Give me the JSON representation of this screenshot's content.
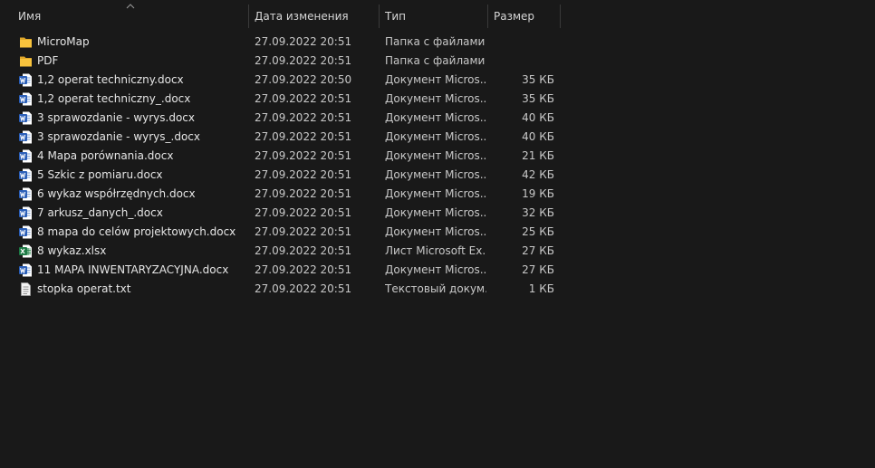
{
  "columns": {
    "name": "Имя",
    "date": "Дата изменения",
    "type": "Тип",
    "size": "Размер"
  },
  "sort": {
    "column": "name",
    "direction": "ascending",
    "indicator": "chevron-up-icon"
  },
  "colors": {
    "background": "#191919",
    "folder": "#f8c33d",
    "word": "#2b5fb8",
    "excel": "#1d7a45"
  },
  "files": [
    {
      "name": "MicroMap",
      "date": "27.09.2022 20:51",
      "type": "Папка с файлами",
      "size": "",
      "icon": "folder-icon"
    },
    {
      "name": "PDF",
      "date": "27.09.2022 20:51",
      "type": "Папка с файлами",
      "size": "",
      "icon": "folder-icon"
    },
    {
      "name": "1,2 operat techniczny.docx",
      "date": "27.09.2022 20:50",
      "type": "Документ Micros...",
      "size": "35 КБ",
      "icon": "word-document-icon"
    },
    {
      "name": "1,2 operat techniczny_.docx",
      "date": "27.09.2022 20:51",
      "type": "Документ Micros...",
      "size": "35 КБ",
      "icon": "word-document-icon"
    },
    {
      "name": "3 sprawozdanie - wyrys.docx",
      "date": "27.09.2022 20:51",
      "type": "Документ Micros...",
      "size": "40 КБ",
      "icon": "word-document-icon"
    },
    {
      "name": "3 sprawozdanie - wyrys_.docx",
      "date": "27.09.2022 20:51",
      "type": "Документ Micros...",
      "size": "40 КБ",
      "icon": "word-document-icon"
    },
    {
      "name": "4 Mapa porównania.docx",
      "date": "27.09.2022 20:51",
      "type": "Документ Micros...",
      "size": "21 КБ",
      "icon": "word-document-icon"
    },
    {
      "name": "5 Szkic z pomiaru.docx",
      "date": "27.09.2022 20:51",
      "type": "Документ Micros...",
      "size": "42 КБ",
      "icon": "word-document-icon"
    },
    {
      "name": "6 wykaz współrzędnych.docx",
      "date": "27.09.2022 20:51",
      "type": "Документ Micros...",
      "size": "19 КБ",
      "icon": "word-document-icon"
    },
    {
      "name": "7 arkusz_danych_.docx",
      "date": "27.09.2022 20:51",
      "type": "Документ Micros...",
      "size": "32 КБ",
      "icon": "word-document-icon"
    },
    {
      "name": "8 mapa do celów projektowych.docx",
      "date": "27.09.2022 20:51",
      "type": "Документ Micros...",
      "size": "25 КБ",
      "icon": "word-document-icon"
    },
    {
      "name": "8 wykaz.xlsx",
      "date": "27.09.2022 20:51",
      "type": "Лист Microsoft Ex...",
      "size": "27 КБ",
      "icon": "excel-spreadsheet-icon"
    },
    {
      "name": "11 MAPA INWENTARYZACYJNA.docx",
      "date": "27.09.2022 20:51",
      "type": "Документ Micros...",
      "size": "27 КБ",
      "icon": "word-document-icon"
    },
    {
      "name": "stopka operat.txt",
      "date": "27.09.2022 20:51",
      "type": "Текстовый докум...",
      "size": "1 КБ",
      "icon": "text-file-icon"
    }
  ]
}
